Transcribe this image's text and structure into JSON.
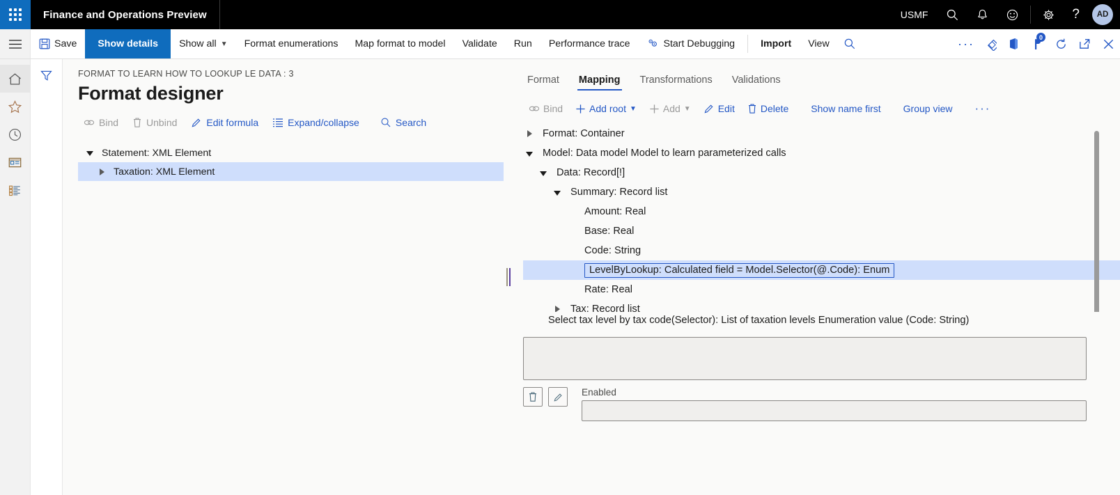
{
  "appbar": {
    "title": "Finance and Operations Preview",
    "company": "USMF",
    "icons": [
      {
        "name": "search-icon",
        "glyph": "search"
      },
      {
        "name": "notifications-bell-icon",
        "glyph": "bell"
      },
      {
        "name": "feedback-smiley-icon",
        "glyph": "smiley"
      },
      {
        "name": "settings-gear-icon",
        "glyph": "gear"
      },
      {
        "name": "help-question-icon",
        "glyph": "question"
      }
    ],
    "avatar_initials": "AD"
  },
  "commandbar": {
    "save_label": "Save",
    "show_details_label": "Show details",
    "show_all_label": "Show all",
    "format_enumerations_label": "Format enumerations",
    "map_format_to_model_label": "Map format to model",
    "validate_label": "Validate",
    "run_label": "Run",
    "performance_trace_label": "Performance trace",
    "start_debugging_label": "Start Debugging",
    "import_label": "Import",
    "view_label": "View",
    "notification_count": "0"
  },
  "navrail": {
    "items": [
      {
        "name": "hamburger-menu-icon",
        "label": "Menu"
      },
      {
        "name": "home-icon",
        "label": "Home"
      },
      {
        "name": "favorites-star-icon",
        "label": "Favorites"
      },
      {
        "name": "recent-clock-icon",
        "label": "Recent"
      },
      {
        "name": "workspaces-icon",
        "label": "Workspaces"
      },
      {
        "name": "modules-list-icon",
        "label": "Modules"
      }
    ]
  },
  "page": {
    "breadcrumb": "FORMAT TO LEARN HOW TO LOOKUP LE DATA : 3",
    "title": "Format designer"
  },
  "format_toolbar": {
    "bind_label": "Bind",
    "unbind_label": "Unbind",
    "edit_formula_label": "Edit formula",
    "expand_collapse_label": "Expand/collapse",
    "search_label": "Search"
  },
  "format_tree": {
    "nodes": [
      {
        "label": "Statement: XML Element",
        "indent": 0,
        "twisty": "down",
        "selected": false
      },
      {
        "label": "Taxation: XML Element",
        "indent": 1,
        "twisty": "right",
        "selected": true
      }
    ]
  },
  "right_tabs": [
    {
      "label": "Format",
      "active": false
    },
    {
      "label": "Mapping",
      "active": true
    },
    {
      "label": "Transformations",
      "active": false
    },
    {
      "label": "Validations",
      "active": false
    }
  ],
  "mapping_toolbar": {
    "bind_label": "Bind",
    "add_root_label": "Add root",
    "add_label": "Add",
    "edit_label": "Edit",
    "delete_label": "Delete",
    "show_name_first_label": "Show name first",
    "group_view_label": "Group view",
    "overflow_label": "···"
  },
  "model_tree": {
    "nodes": [
      {
        "label": "Format: Container",
        "indent": 0,
        "twisty": "right",
        "selected": false,
        "boxed": false
      },
      {
        "label": "Model: Data model Model to learn parameterized calls",
        "indent": 0,
        "twisty": "down",
        "selected": false,
        "boxed": false
      },
      {
        "label": "Data: Record[!]",
        "indent": 1,
        "twisty": "down",
        "selected": false,
        "boxed": false
      },
      {
        "label": "Summary: Record list",
        "indent": 2,
        "twisty": "down",
        "selected": false,
        "boxed": false
      },
      {
        "label": "Amount: Real",
        "indent": 3,
        "twisty": "none",
        "selected": false,
        "boxed": false
      },
      {
        "label": "Base: Real",
        "indent": 3,
        "twisty": "none",
        "selected": false,
        "boxed": false
      },
      {
        "label": "Code: String",
        "indent": 3,
        "twisty": "none",
        "selected": false,
        "boxed": false
      },
      {
        "label": "LevelByLookup: Calculated field = Model.Selector(@.Code): Enum",
        "indent": 3,
        "twisty": "none",
        "selected": true,
        "boxed": true
      },
      {
        "label": "Rate: Real",
        "indent": 3,
        "twisty": "none",
        "selected": false,
        "boxed": false
      },
      {
        "label": "Tax: Record list",
        "indent": 2,
        "twisty": "right",
        "selected": false,
        "boxed": false
      }
    ]
  },
  "detail": {
    "description": "Select tax level by tax code(Selector): List of taxation levels Enumeration value (Code: String)",
    "formula_value": "",
    "enabled_label": "Enabled",
    "enabled_value": ""
  },
  "colors": {
    "accent": "#0f6cbd",
    "link": "#2357c5",
    "selection": "#cfdefc",
    "appbar_bg": "#000000",
    "content_bg": "#fafaf9"
  }
}
